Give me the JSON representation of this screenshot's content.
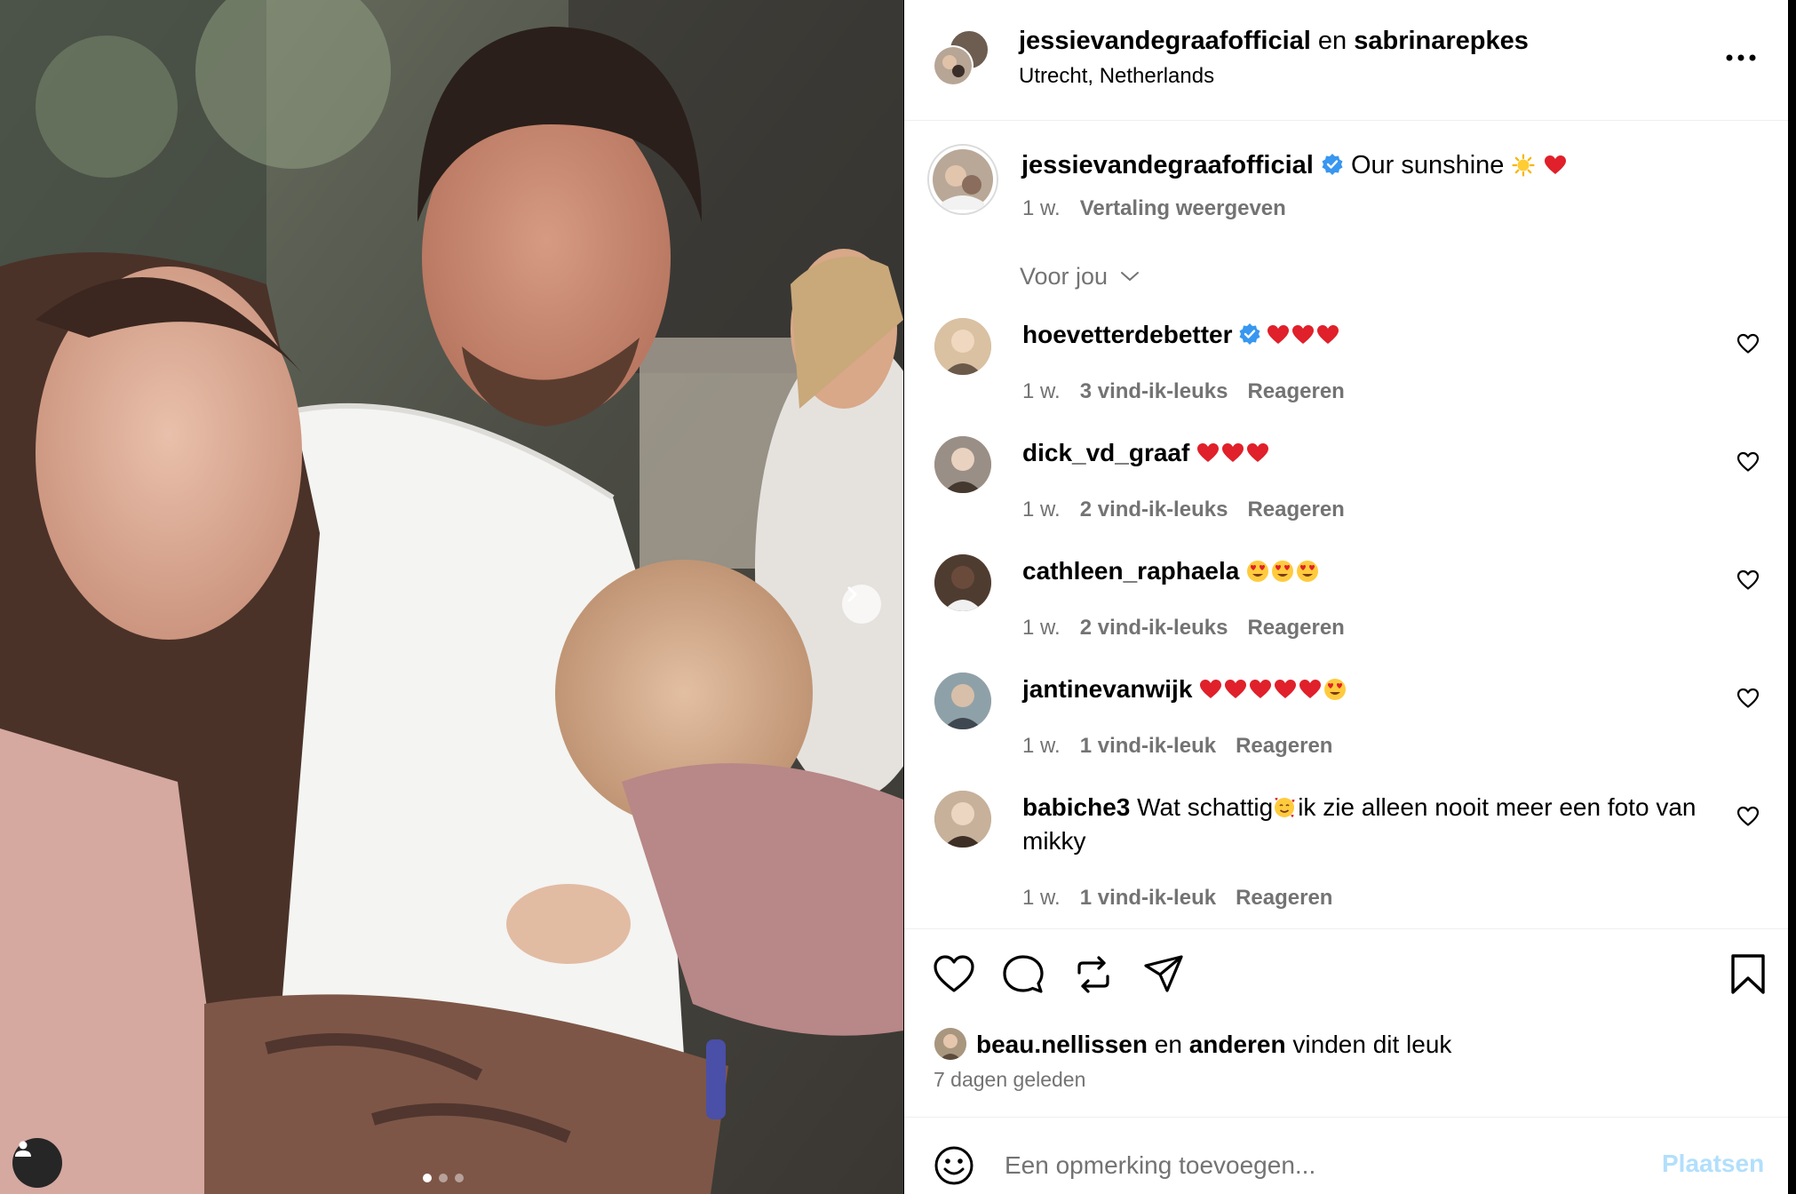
{
  "header": {
    "user1": "jessievandegraafofficial",
    "conj": "en",
    "user2": "sabrinarepkes",
    "location": "Utrecht, Netherlands",
    "more_icon": "more-horizontal-icon"
  },
  "caption": {
    "username": "jessievandegraafofficial",
    "text": "Our sunshine",
    "emojis": [
      "sun-emoji",
      "red-heart-emoji"
    ],
    "age": "1 w.",
    "translate": "Vertaling weergeven"
  },
  "filter": {
    "label": "Voor jou"
  },
  "comments": [
    {
      "username": "hoevetterdebetter",
      "verified": true,
      "text": "",
      "emojis": [
        "red-heart",
        "red-heart",
        "red-heart"
      ],
      "age": "1 w.",
      "likes": "3 vind-ik-leuks",
      "reply": "Reageren"
    },
    {
      "username": "dick_vd_graaf",
      "verified": false,
      "text": "",
      "emojis": [
        "red-heart",
        "red-heart",
        "red-heart"
      ],
      "age": "1 w.",
      "likes": "2 vind-ik-leuks",
      "reply": "Reageren"
    },
    {
      "username": "cathleen_raphaela",
      "verified": false,
      "text": "",
      "emojis": [
        "heart-eyes",
        "heart-eyes",
        "heart-eyes"
      ],
      "age": "1 w.",
      "likes": "2 vind-ik-leuks",
      "reply": "Reageren"
    },
    {
      "username": "jantinevanwijk",
      "verified": false,
      "text": "",
      "emojis": [
        "red-heart",
        "red-heart",
        "red-heart",
        "red-heart",
        "red-heart",
        "heart-eyes"
      ],
      "age": "1 w.",
      "likes": "1 vind-ik-leuk",
      "reply": "Reageren"
    },
    {
      "username": "babiche3",
      "verified": false,
      "text_before": "Wat schattig",
      "text_after": "ik zie alleen nooit meer een foto van mikky",
      "emojis": [
        "smiling-hearts"
      ],
      "age": "1 w.",
      "likes": "1 vind-ik-leuk",
      "reply": "Reageren"
    }
  ],
  "likes_summary": {
    "user": "beau.nellissen",
    "conj": "en",
    "others": "anderen",
    "suffix": "vinden dit leuk"
  },
  "post_date": "7 dagen geleden",
  "add_comment": {
    "placeholder": "Een opmerking toevoegen...",
    "post_label": "Plaatsen"
  },
  "carousel": {
    "count": 3,
    "active": 1
  },
  "colors": {
    "secondary_text": "#737373",
    "verified_blue": "#3897f0",
    "post_button_disabled": "#b2dffc",
    "divider": "#efefef"
  }
}
